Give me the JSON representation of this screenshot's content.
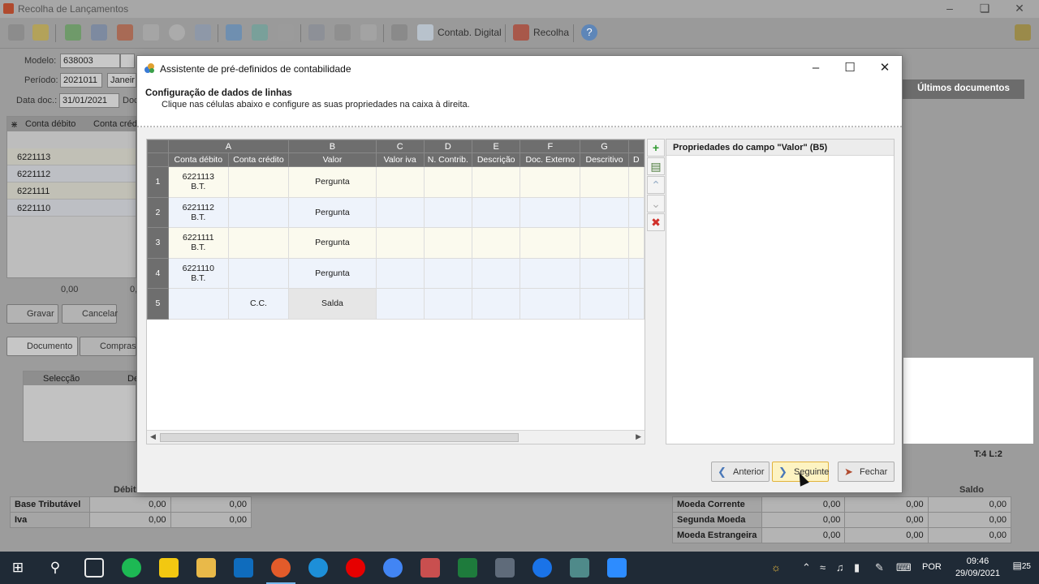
{
  "main": {
    "title": "Recolha de Lançamentos",
    "toolbar": {
      "contab_label": "Contab. Digital",
      "recolha_label": "Recolha"
    },
    "modelo_label": "Modelo:",
    "modelo_value": "638003",
    "periodo_label": "Período:",
    "periodo_value": "2021011",
    "periodo_month": "Janeir",
    "datadoc_label": "Data doc.:",
    "datadoc_value": "31/01/2021",
    "doc_label": "Doc",
    "grid": {
      "col1": "Conta débito",
      "col2": "Conta crédit",
      "rows": [
        "6221113",
        "6221112",
        "6221111",
        "6221110"
      ]
    },
    "totals": {
      "left": "0,00",
      "right": "0,"
    },
    "btn_gravar": "Gravar",
    "btn_cancelar": "Cancelar",
    "tab_documento": "Documento",
    "tab_compras": "Compras",
    "sub_grid": {
      "col1": "Selecção",
      "col2": "De"
    },
    "ultimos_docs": "Últimos documentos",
    "status_right": "T:4 L:2",
    "summary_left": {
      "headers": [
        "Débit"
      ],
      "rows": [
        {
          "label": "Base Tributável",
          "v1": "0,00",
          "v2": "0,00"
        },
        {
          "label": "Iva",
          "v1": "0,00",
          "v2": "0,00"
        }
      ]
    },
    "summary_right": {
      "header": "Saldo",
      "rows": [
        {
          "label": "Moeda Corrente",
          "v1": "0,00",
          "v2": "0,00",
          "v3": "0,00"
        },
        {
          "label": "Segunda Moeda",
          "v1": "0,00",
          "v2": "0,00",
          "v3": "0,00"
        },
        {
          "label": "Moeda Estrangeira",
          "v1": "0,00",
          "v2": "0,00",
          "v3": "0,00"
        }
      ]
    }
  },
  "dialog": {
    "title": "Assistente de pré-definidos de contabilidade",
    "heading": "Configuração de dados de linhas",
    "subheading": "Clique nas células abaixo e configure as suas propriedades na caixa à direita.",
    "table": {
      "letters": [
        "A",
        "B",
        "C",
        "D",
        "E",
        "F",
        "G"
      ],
      "columns": [
        "Conta débito",
        "Conta crédito",
        "Valor",
        "Valor iva",
        "N. Contrib.",
        "Descrição",
        "Doc. Externo",
        "Descritivo",
        "D"
      ],
      "rows": [
        {
          "n": "1",
          "debito": "6221113",
          "debito2": "B.T.",
          "credito": "",
          "valor": "Pergunta"
        },
        {
          "n": "2",
          "debito": "6221112",
          "debito2": "B.T.",
          "credito": "",
          "valor": "Pergunta"
        },
        {
          "n": "3",
          "debito": "6221111",
          "debito2": "B.T.",
          "credito": "",
          "valor": "Pergunta"
        },
        {
          "n": "4",
          "debito": "6221110",
          "debito2": "B.T.",
          "credito": "",
          "valor": "Pergunta"
        },
        {
          "n": "5",
          "debito": "",
          "debito2": "",
          "credito": "C.C.",
          "valor": "Salda"
        }
      ]
    },
    "props_title": "Propriedades do campo \"Valor\" (B5)",
    "btn_anterior": "Anterior",
    "btn_seguinte": "Seguinte",
    "btn_fechar": "Fechar"
  },
  "taskbar": {
    "lang": "POR",
    "time": "09:46",
    "date": "29/09/2021",
    "notifications": "25"
  },
  "colors": {
    "accent": "#0078d7",
    "focus_button": "#fdf3c2",
    "grid_header": "#6e6e6e",
    "row_cream": "#fbfaee",
    "row_blue": "#eef3fb"
  }
}
